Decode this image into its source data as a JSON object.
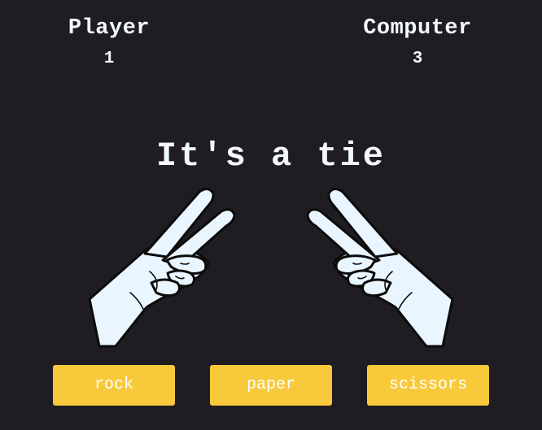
{
  "scoreboard": {
    "player": {
      "label": "Player",
      "score": "1"
    },
    "computer": {
      "label": "Computer",
      "score": "3"
    }
  },
  "result": {
    "message": "It's a tie"
  },
  "hands": {
    "player": {
      "choice": "scissors",
      "icon": "scissors-hand-icon"
    },
    "computer": {
      "choice": "scissors",
      "icon": "scissors-hand-icon"
    }
  },
  "controls": {
    "rock_label": "rock",
    "paper_label": "paper",
    "scissors_label": "scissors"
  },
  "colors": {
    "background": "#1f1d22",
    "text": "#f2f8ff",
    "button": "#f9c93c",
    "hand_fill": "#e9f6ff"
  }
}
